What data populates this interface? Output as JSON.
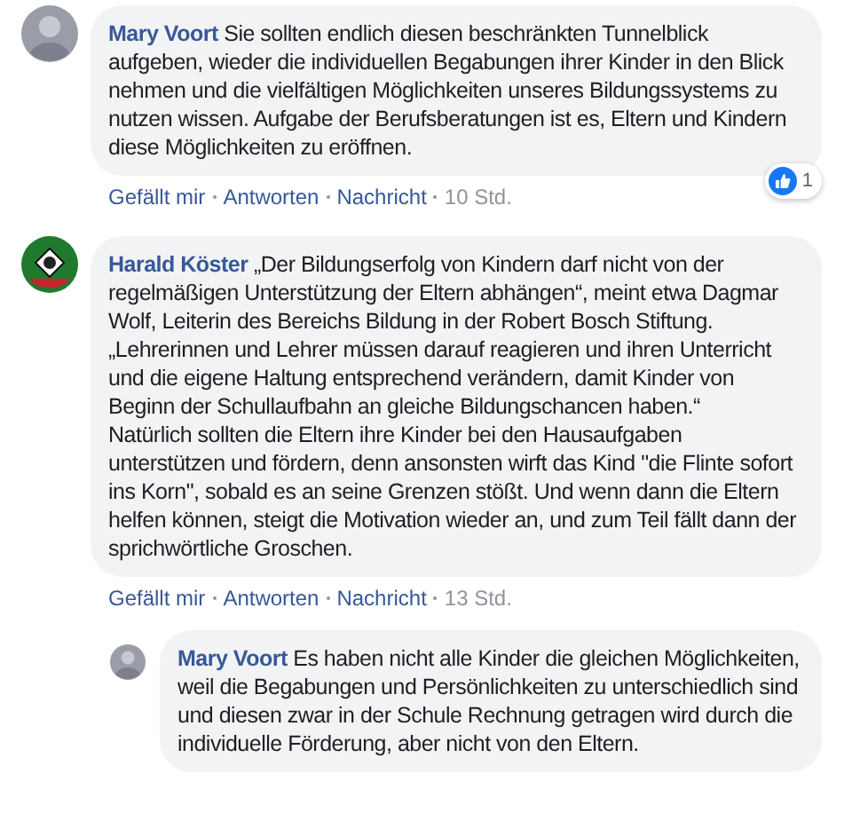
{
  "comments": [
    {
      "author": "Mary Voort",
      "avatar": {
        "kind": "photo"
      },
      "paragraphs": [
        "Sie sollten endlich diesen beschränkten Tunnelblick aufgeben, wieder die individuellen Begabungen ihrer Kinder in den Blick nehmen und die vielfältigen Möglichkeiten unseres Bildungssystems zu nutzen wissen. Aufgabe der Berufsberatungen ist es, Eltern und Kindern diese Möglichkeiten zu eröffnen."
      ],
      "actions": [
        "Gefällt mir",
        "Antworten",
        "Nachricht"
      ],
      "time": "10 Std.",
      "reactions": "1"
    },
    {
      "author": "Harald Köster",
      "avatar": {
        "kind": "crest"
      },
      "paragraphs": [
        "„Der Bildungserfolg von Kindern darf nicht von der regelmäßigen Unterstützung der Eltern abhängen“, meint etwa Dagmar Wolf, Leiterin des Bereichs Bildung in der Robert Bosch Stiftung. „Lehrerinnen und Lehrer müssen darauf reagieren und ihren Unterricht und die eigene Haltung entsprechend verändern, damit Kinder von Beginn der Schullaufbahn an gleiche Bildungschancen haben.“",
        "Natürlich sollten die Eltern ihre Kinder bei den Hausaufgaben unterstützen und fördern, denn ansonsten wirft das Kind \"die Flinte sofort ins Korn\", sobald es an seine Grenzen stößt. Und wenn dann die Eltern helfen können, steigt die Motivation wieder an, und zum Teil fällt dann der sprichwörtliche Groschen."
      ],
      "actions": [
        "Gefällt mir",
        "Antworten",
        "Nachricht"
      ],
      "time": "13 Std.",
      "replies": [
        {
          "author": "Mary Voort",
          "avatar": {
            "kind": "photo"
          },
          "paragraphs": [
            "Es haben nicht alle Kinder die gleichen Möglichkeiten, weil die Begabungen und Persönlichkeiten zu unterschiedlich sind und diesen zwar in der Schule Rechnung getragen wird durch die individuelle Förderung, aber nicht von den Eltern."
          ]
        }
      ]
    }
  ]
}
